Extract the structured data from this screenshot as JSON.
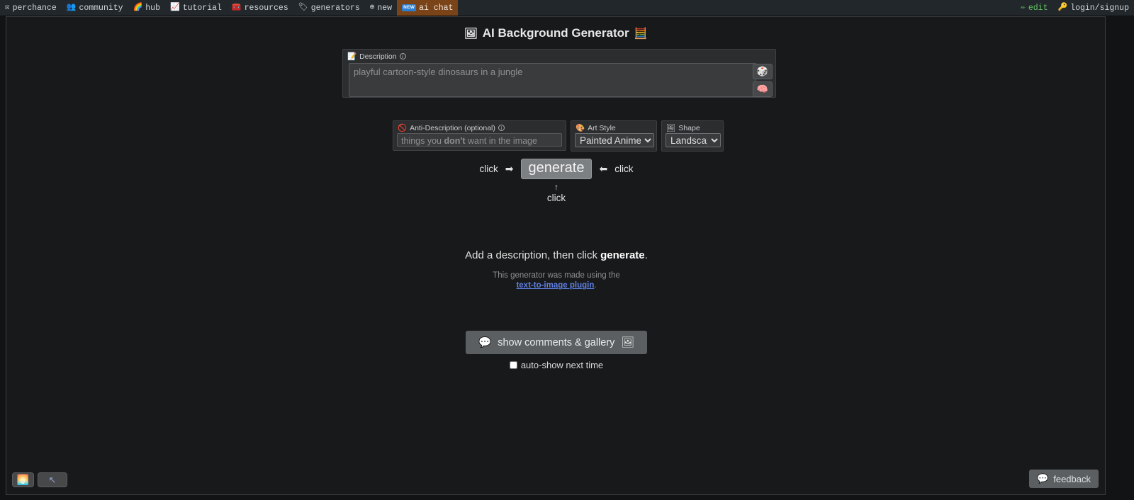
{
  "topnav": {
    "items": [
      {
        "label": "perchance",
        "icon": "perchance-logo-icon",
        "glyph": "☒"
      },
      {
        "label": "community",
        "icon": "people-icon",
        "glyph": "👥"
      },
      {
        "label": "hub",
        "icon": "rainbow-icon",
        "glyph": "🌈"
      },
      {
        "label": "tutorial",
        "icon": "chart-icon",
        "glyph": "📈"
      },
      {
        "label": "resources",
        "icon": "toolbox-icon",
        "glyph": "🧰"
      },
      {
        "label": "generators",
        "icon": "label-icon",
        "glyph": "🏷"
      },
      {
        "label": "new",
        "icon": "globe-icon",
        "glyph": "⊕"
      }
    ],
    "aichat": {
      "label": "ai chat",
      "badge": "NEW",
      "badge_color": "#2f7fd1",
      "tab_color": "#7a4418"
    },
    "edit": {
      "label": "edit",
      "icon": "pencil-icon",
      "glyph": "✏",
      "color": "#64c264"
    },
    "login": {
      "label": "login/signup",
      "icon": "key-icon",
      "glyph": "🔑"
    }
  },
  "page": {
    "title": "AI Background Generator",
    "title_icon_left": "🖼",
    "title_icon_right": "🧮"
  },
  "description": {
    "label": "Description",
    "label_icon": "📝",
    "info_glyph": "i",
    "value": "",
    "placeholder": "playful cartoon-style dinosaurs in a jungle",
    "dice_button_icon": "🎲",
    "brain_button_icon": "🧠"
  },
  "anti_description": {
    "label": "Anti-Description (optional)",
    "label_icon": "🚫",
    "info_glyph": "i",
    "value": "",
    "placeholder": "things you don't want in the image",
    "placeholder_prefix": "things you ",
    "placeholder_bold": "don't",
    "placeholder_suffix": " want in the image"
  },
  "art_style": {
    "label": "Art Style",
    "label_icon": "🎨",
    "selected": "Painted Anime",
    "options": [
      "Painted Anime"
    ]
  },
  "shape": {
    "label": "Shape",
    "label_icon": "🖼",
    "selected": "Landscape",
    "options": [
      "Landscape"
    ]
  },
  "generate": {
    "button_label": "generate",
    "left_hint": "click",
    "left_arrow": "➡",
    "right_arrow": "⬅",
    "right_hint": "click",
    "below_arrow": "↑",
    "below_hint": "click"
  },
  "hint": {
    "prefix": "Add a description, then click ",
    "bold": "generate",
    "suffix": "."
  },
  "credit": {
    "line1": "This generator was made using the",
    "link": "text-to-image plugin",
    "period": "."
  },
  "comments": {
    "button_label": "show comments & gallery",
    "button_icon_left": "💬",
    "button_icon_right": "🖼",
    "autoshow_label": "auto-show next time",
    "autoshow_checked": false
  },
  "corner": {
    "image_button_icon": "🌅",
    "arrow_button_icon": "↖",
    "feedback_label": "feedback",
    "feedback_icon": "💬"
  }
}
